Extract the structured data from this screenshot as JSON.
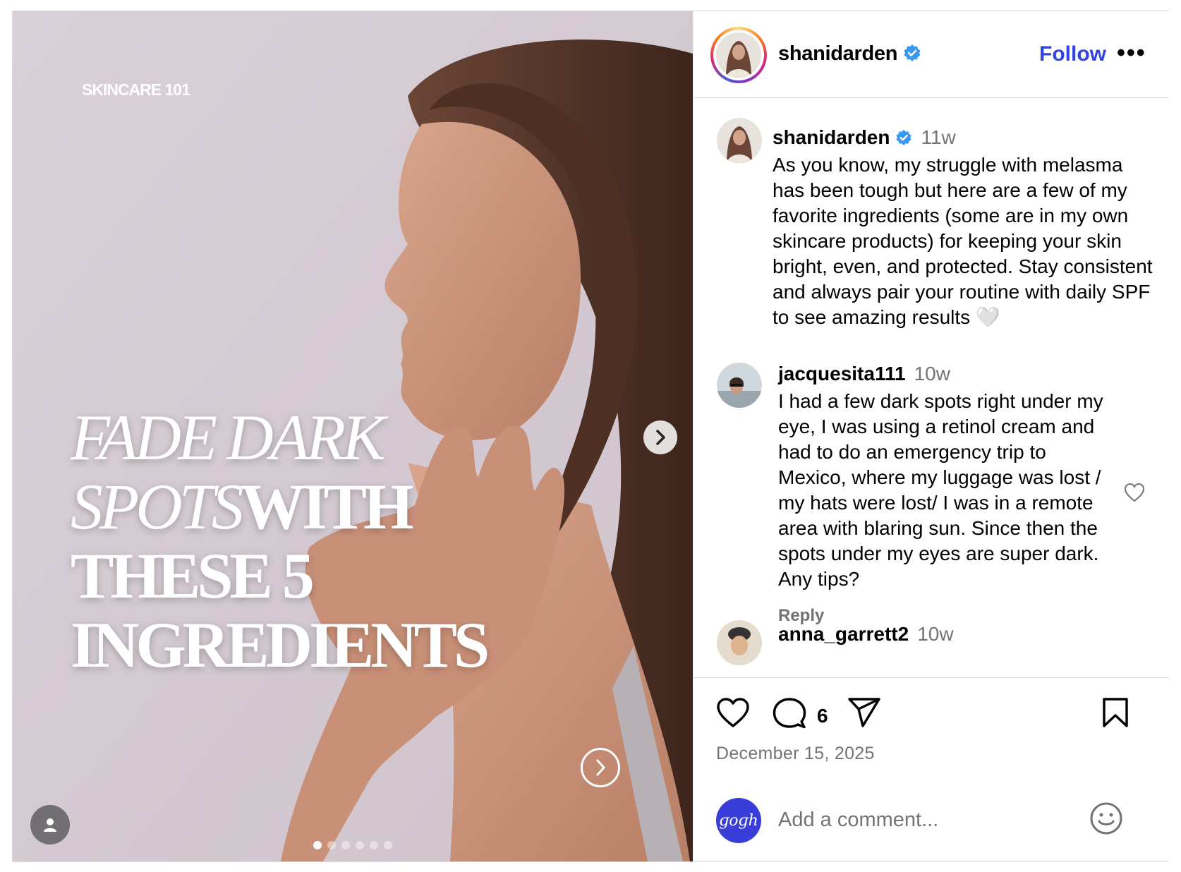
{
  "post": {
    "username": "shanidarden",
    "follow_label": "Follow",
    "more_label": "•••",
    "date": "December 15, 2025",
    "comment_count": "6"
  },
  "media": {
    "eyebrow": "SKINCARE 101",
    "headline": {
      "line1": "FADE DARK",
      "line2_italic": "SPOTS",
      "line2_bold": "WITH",
      "line3": "THESE 5",
      "line4": "INGREDIENTS"
    },
    "slide_count": 6,
    "active_slide": 1
  },
  "caption": {
    "username": "shanidarden",
    "time": "11w",
    "text": "As you know, my struggle with melasma has been tough but here are a few of my favorite ingredients (some are in my own skincare products) for keeping your skin bright, even, and protected. Stay consistent and always pair your routine with daily SPF to see amazing results 🤍"
  },
  "comments": [
    {
      "username": "jacquesita111",
      "time": "10w",
      "text": "I had a few dark spots right under my eye, I was using a retinol cream and had to do an emergency trip to Mexico, where my luggage was lost / my hats were lost/ I was in a remote area with blaring sun. Since then the spots under my eyes are super dark. Any tips?",
      "reply_label": "Reply"
    },
    {
      "username": "anna_garrett2",
      "time": "10w"
    }
  ],
  "comment_box": {
    "placeholder": "Add a comment...",
    "avatar_text": "ɡoɡh"
  },
  "colors": {
    "follow": "#3143e6",
    "verified": "#3897f0",
    "muted": "#737373",
    "divider": "#dbdbdb"
  },
  "icons": [
    "verified-badge-icon",
    "more-icon",
    "heart-icon",
    "comment-icon",
    "share-icon",
    "bookmark-icon",
    "emoji-icon",
    "chevron-right-icon",
    "user-tag-icon"
  ]
}
